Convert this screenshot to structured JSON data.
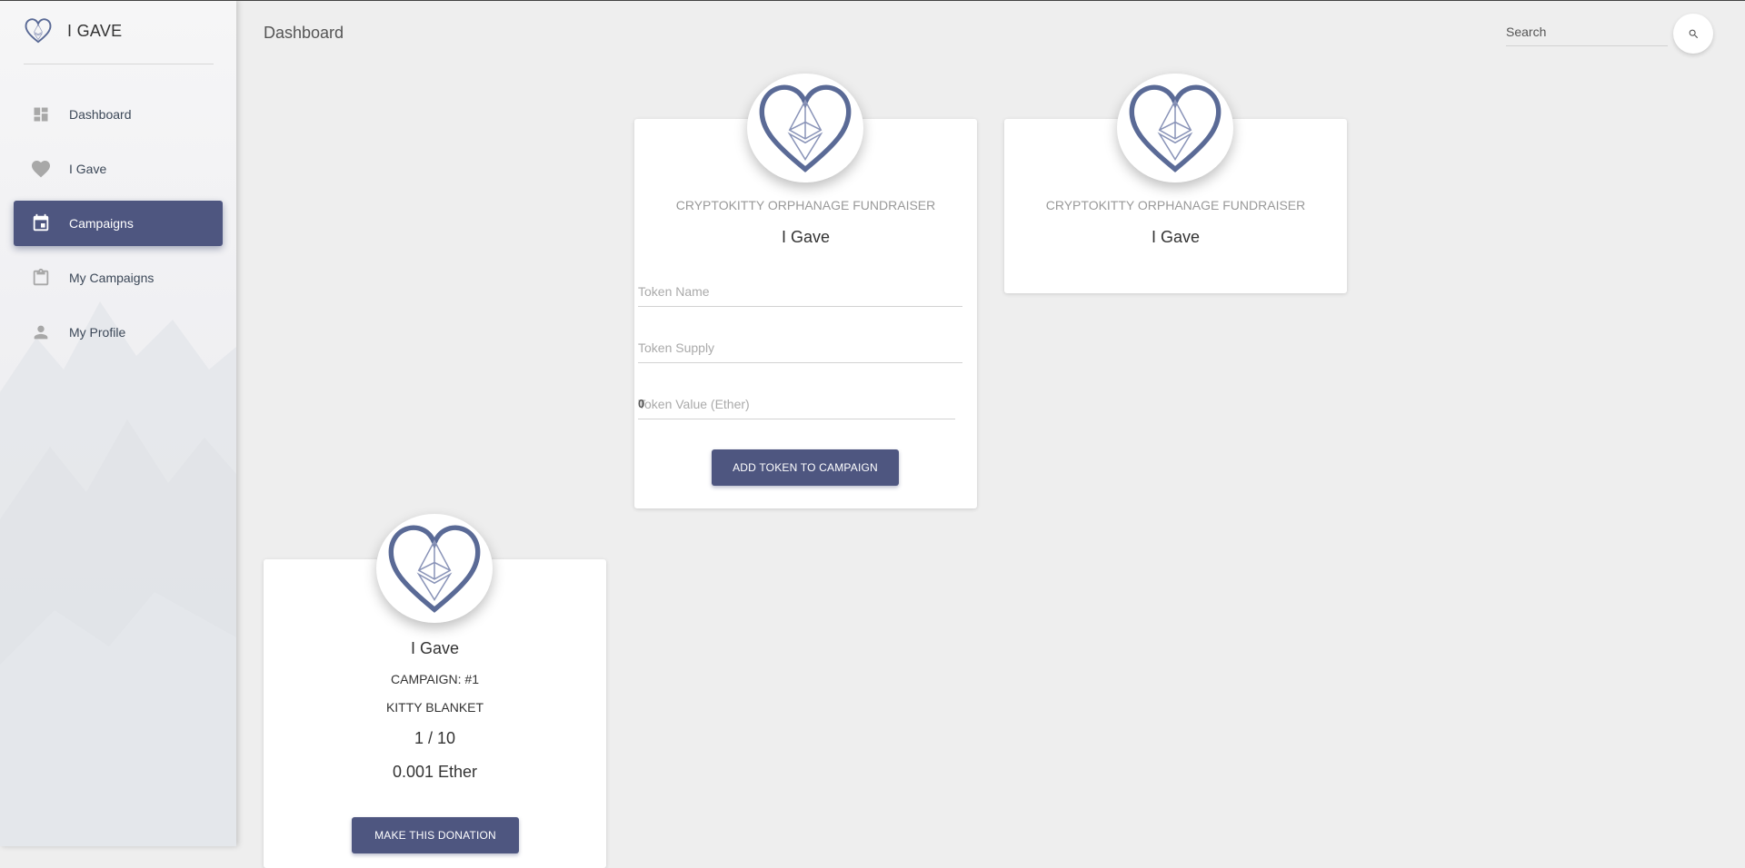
{
  "brand": {
    "title": "I GAVE",
    "logo_icon": "heart-ethereum-logo"
  },
  "sidebar": {
    "items": [
      {
        "label": "Dashboard",
        "icon": "dashboard-icon",
        "active": false
      },
      {
        "label": "I Gave",
        "icon": "heart-icon",
        "active": false
      },
      {
        "label": "Campaigns",
        "icon": "calendar-icon",
        "active": true
      },
      {
        "label": "My Campaigns",
        "icon": "clipboard-icon",
        "active": false
      },
      {
        "label": "My Profile",
        "icon": "person-icon",
        "active": false
      }
    ]
  },
  "header": {
    "title": "Dashboard",
    "search_placeholder": "Search",
    "search_icon": "search-icon"
  },
  "cards": {
    "campaign_form": {
      "category": "CRYPTOKITTY ORPHANAGE FUNDRAISER",
      "title": "I Gave",
      "token_name_placeholder": "Token Name",
      "token_supply_placeholder": "Token Supply",
      "token_value_placeholder": "Token Value (Ether)",
      "token_value_prefix": "0",
      "button_label": "ADD TOKEN TO CAMPAIGN"
    },
    "campaign_simple": {
      "category": "CRYPTOKITTY ORPHANAGE FUNDRAISER",
      "title": "I Gave"
    },
    "donation": {
      "title": "I Gave",
      "campaign": "CAMPAIGN: #1",
      "item": "KITTY BLANKET",
      "count": "1 / 10",
      "price": "0.001 Ether",
      "button_label": "MAKE THIS DONATION"
    }
  },
  "colors": {
    "accent": "#4e5680",
    "logo": "#5a6a96",
    "background": "#eeeeee"
  }
}
